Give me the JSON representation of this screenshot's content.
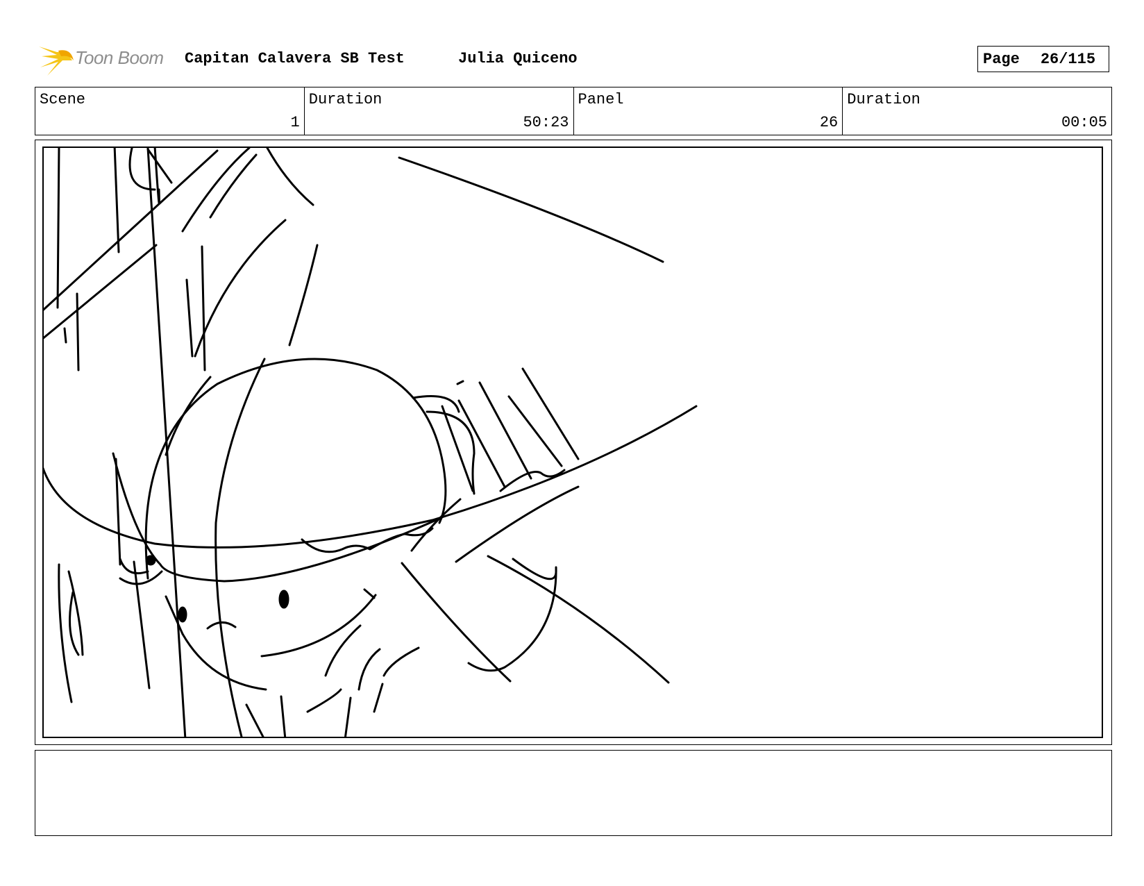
{
  "header": {
    "logo_text": "Toon Boom",
    "project_title": "Capitan Calavera SB Test",
    "author": "Julia Quiceno",
    "page_label": "Page",
    "page_value": "26/115"
  },
  "info": {
    "scene_label": "Scene",
    "scene_value": "1",
    "scene_duration_label": "Duration",
    "scene_duration_value": "50:23",
    "panel_label": "Panel",
    "panel_value": "26",
    "panel_duration_label": "Duration",
    "panel_duration_value": "00:05"
  },
  "panel": {
    "image": "pencil storyboard sketch of a character in a wide-brimmed hat"
  },
  "notes": {
    "text": ""
  },
  "colors": {
    "logo_star": "#f5c518",
    "logo_text": "#8d8d8d",
    "ink": "#000000"
  }
}
